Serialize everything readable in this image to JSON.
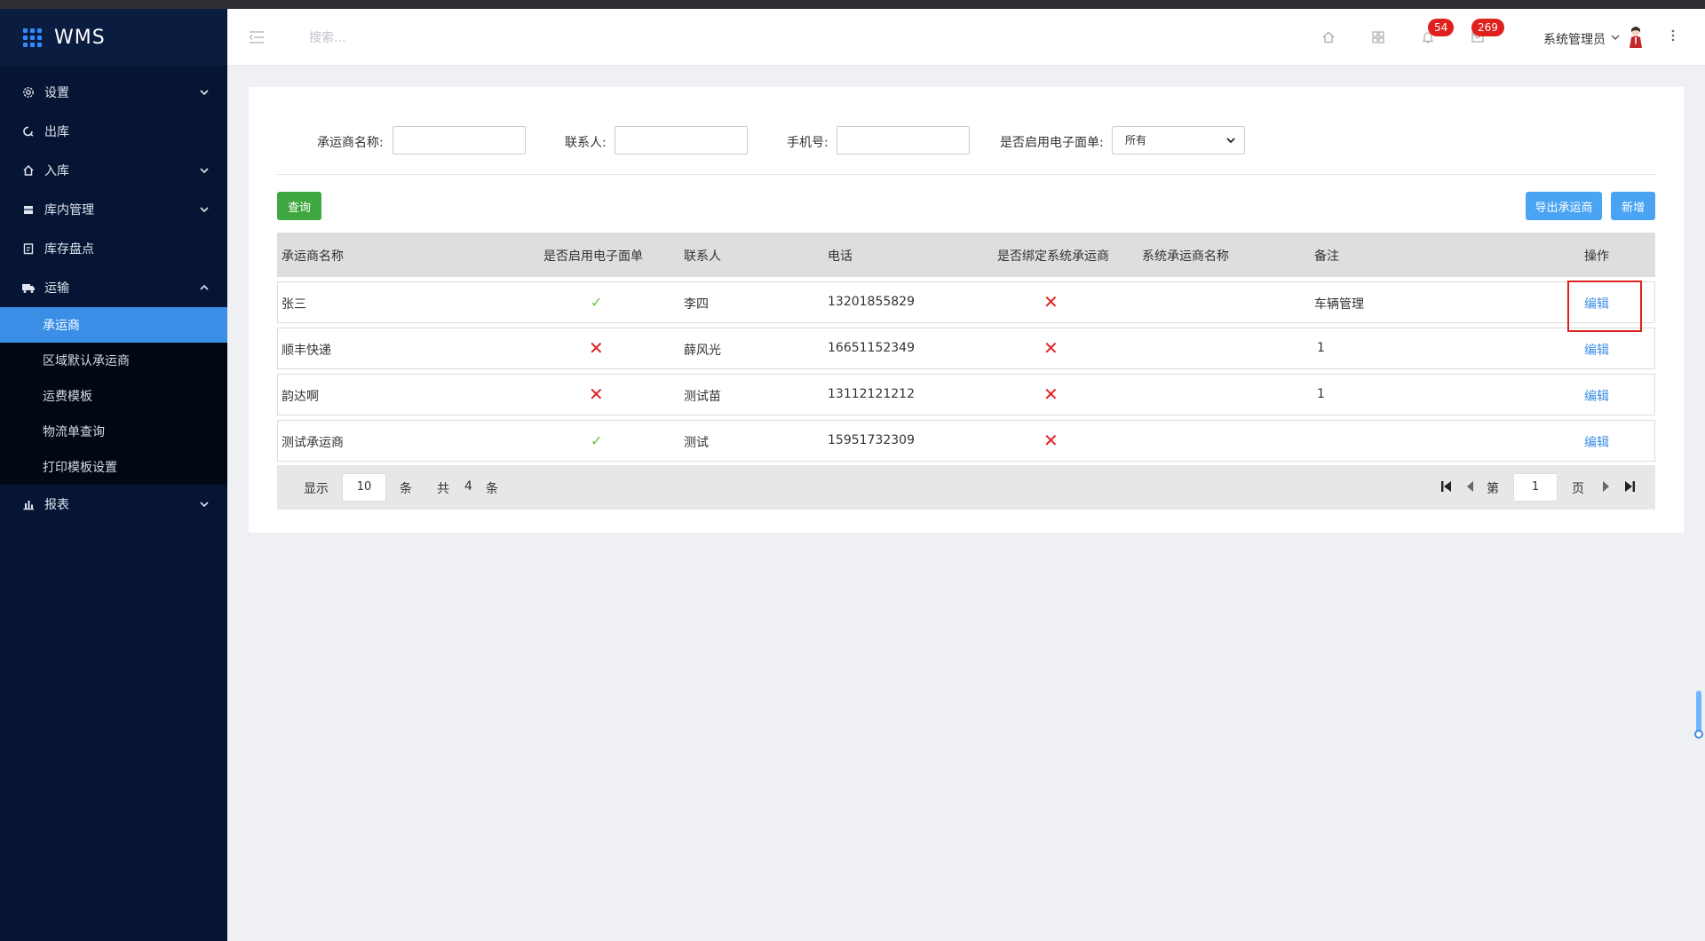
{
  "app": {
    "logo_text": "WMS"
  },
  "sidebar": {
    "items": [
      {
        "label": "设置",
        "icon": "gear-icon",
        "caret": "down"
      },
      {
        "label": "出库",
        "icon": "outbound-icon"
      },
      {
        "label": "入库",
        "icon": "home-icon",
        "caret": "down"
      },
      {
        "label": "库内管理",
        "icon": "box-icon",
        "caret": "down"
      },
      {
        "label": "库存盘点",
        "icon": "inventory-icon"
      },
      {
        "label": "运输",
        "icon": "truck-icon",
        "caret": "up"
      },
      {
        "label": "报表",
        "icon": "bar-chart-icon",
        "caret": "down"
      }
    ],
    "submenu": [
      {
        "label": "承运商",
        "active": true
      },
      {
        "label": "区域默认承运商"
      },
      {
        "label": "运费模板"
      },
      {
        "label": "物流单查询"
      },
      {
        "label": "打印模板设置"
      }
    ]
  },
  "header": {
    "search_placeholder": "搜索...",
    "badge_notifications": "54",
    "badge_messages": "269",
    "user_name": "系统管理员"
  },
  "filters": {
    "carrier_name_label": "承运商名称:",
    "contact_label": "联系人:",
    "phone_label": "手机号:",
    "e_waybill_label": "是否启用电子面单:",
    "e_waybill_selected": "所有"
  },
  "buttons": {
    "query": "查询",
    "export": "导出承运商",
    "add": "新增"
  },
  "table": {
    "headers": [
      "承运商名称",
      "是否启用电子面单",
      "联系人",
      "电话",
      "是否绑定系统承运商",
      "系统承运商名称",
      "备注",
      "操作"
    ],
    "rows": [
      {
        "name": "张三",
        "e_waybill": true,
        "contact": "李四",
        "phone": "13201855829",
        "bound": false,
        "sys_name": "",
        "remark": "车辆管理",
        "action": "编辑"
      },
      {
        "name": "顺丰快递",
        "e_waybill": false,
        "contact": "薛风光",
        "phone": "16651152349",
        "bound": false,
        "sys_name": "",
        "remark": "1",
        "action": "编辑"
      },
      {
        "name": "韵达啊",
        "e_waybill": false,
        "contact": "测试苗",
        "phone": "13112121212",
        "bound": false,
        "sys_name": "",
        "remark": "1",
        "action": "编辑"
      },
      {
        "name": "测试承运商",
        "e_waybill": true,
        "contact": "测试",
        "phone": "15951732309",
        "bound": false,
        "sys_name": "",
        "remark": "",
        "action": "编辑"
      }
    ]
  },
  "pager": {
    "show_label": "显示",
    "page_size": "10",
    "unit": "条",
    "total_label": "共",
    "total": "4",
    "total_unit": "条",
    "page_prefix": "第",
    "page": "1",
    "page_suffix": "页"
  },
  "colors": {
    "sidebar_bg": "#061533",
    "active_item": "#3a8ee6",
    "query_button": "#3fa73f",
    "primary_button": "#4aa3f3",
    "badge": "#e0201d",
    "check": "#67c23a",
    "cross": "#e02020"
  },
  "symbols": {
    "check": "✓",
    "cross": "✕"
  }
}
